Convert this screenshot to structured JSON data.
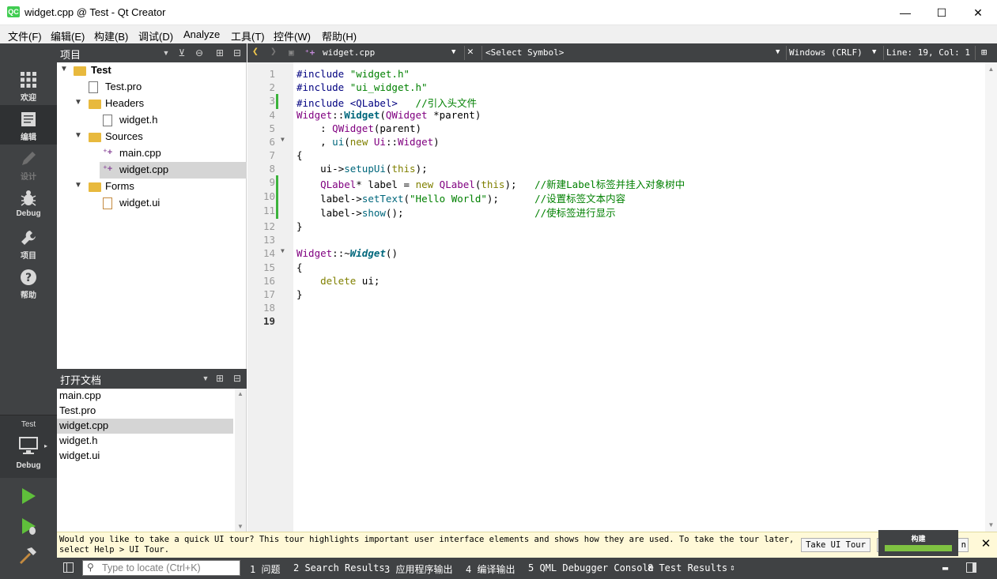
{
  "window": {
    "logo": "QC",
    "title": "widget.cpp @ Test - Qt Creator",
    "minimize": "—",
    "maximize": "☐",
    "close": "✕"
  },
  "menu": [
    "文件(F)",
    "编辑(E)",
    "构建(B)",
    "调试(D)",
    "Analyze",
    "工具(T)",
    "控件(W)",
    "帮助(H)"
  ],
  "modes": [
    {
      "label": "欢迎",
      "icon": "grid-icon"
    },
    {
      "label": "编辑",
      "icon": "document-icon"
    },
    {
      "label": "设计",
      "icon": "pencil-icon"
    },
    {
      "label": "Debug",
      "icon": "bug-icon"
    },
    {
      "label": "项目",
      "icon": "wrench-icon"
    },
    {
      "label": "帮助",
      "icon": "help-icon"
    }
  ],
  "kit": {
    "project": "Test",
    "build": "Debug"
  },
  "projects_pane": {
    "title": "项目",
    "tree": [
      {
        "label": "Test",
        "bold": true
      },
      {
        "label": "Test.pro"
      },
      {
        "label": "Headers"
      },
      {
        "label": "widget.h"
      },
      {
        "label": "Sources"
      },
      {
        "label": "main.cpp"
      },
      {
        "label": "widget.cpp",
        "selected": true
      },
      {
        "label": "Forms"
      },
      {
        "label": "widget.ui"
      }
    ]
  },
  "open_docs": {
    "title": "打开文档",
    "items": [
      "main.cpp",
      "Test.pro",
      "widget.cpp",
      "widget.h",
      "widget.ui"
    ],
    "selected_index": 2
  },
  "editor_toolbar": {
    "file": "widget.cpp",
    "symbol": "<Select Symbol>",
    "line_ending": "Windows (CRLF)",
    "position": "Line: 19, Col: 1"
  },
  "code": {
    "current_line": 19,
    "lines": [
      "#include \"widget.h\"",
      "#include \"ui_widget.h\"",
      "#include <QLabel>   //引入头文件",
      "Widget::Widget(QWidget *parent)",
      "    : QWidget(parent)",
      "    , ui(new Ui::Widget)",
      "{",
      "    ui->setupUi(this);",
      "    QLabel* label = new QLabel(this);   //新建Label标签并挂入对象树中",
      "    label->setText(\"Hello World\");      //设置标签文本内容",
      "    label->show();                      //使标签进行显示",
      "}",
      "",
      "Widget::~Widget()",
      "{",
      "    delete ui;",
      "}",
      "",
      ""
    ]
  },
  "tour": {
    "text": "Would you like to take a quick UI tour? This tour highlights important user interface elements and shows how they are used. To take the tour later, select Help > UI Tour.",
    "take_button": "Take UI Tour",
    "hidden_button": "n"
  },
  "build_progress": {
    "label": "构建",
    "progress": 1.0,
    "color": "#7fc241"
  },
  "statusbar": {
    "locator_placeholder": "Type to locate (Ctrl+K)",
    "panes": [
      "1 问题",
      "2 Search Results",
      "3 应用程序输出",
      "4 编译输出",
      "5 QML Debugger Console",
      "8 Test Results"
    ]
  }
}
